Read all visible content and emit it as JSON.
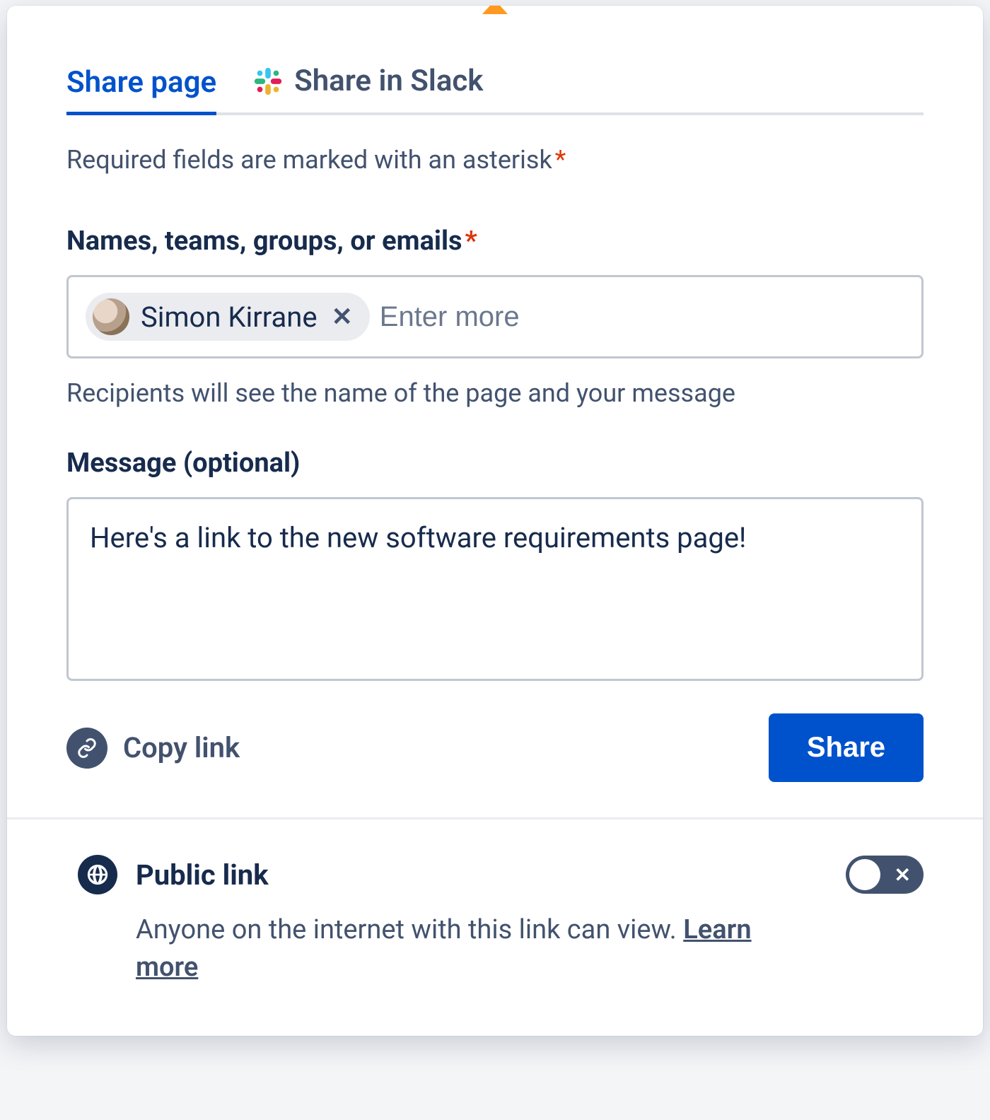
{
  "tabs": {
    "share_page": "Share page",
    "share_slack": "Share in Slack"
  },
  "required_hint": "Required fields are marked with an asterisk",
  "recipients": {
    "label": "Names, teams, groups, or emails",
    "chip_name": "Simon Kirrane",
    "placeholder": "Enter more",
    "helper": "Recipients will see the name of the page and your message"
  },
  "message": {
    "label": "Message (optional)",
    "value": "Here's a link to the new software requirements page!"
  },
  "actions": {
    "copy_link": "Copy link",
    "share": "Share"
  },
  "public": {
    "title": "Public link",
    "description": "Anyone on the internet with this link can view. ",
    "learn_more": "Learn more",
    "toggle_on": false
  }
}
